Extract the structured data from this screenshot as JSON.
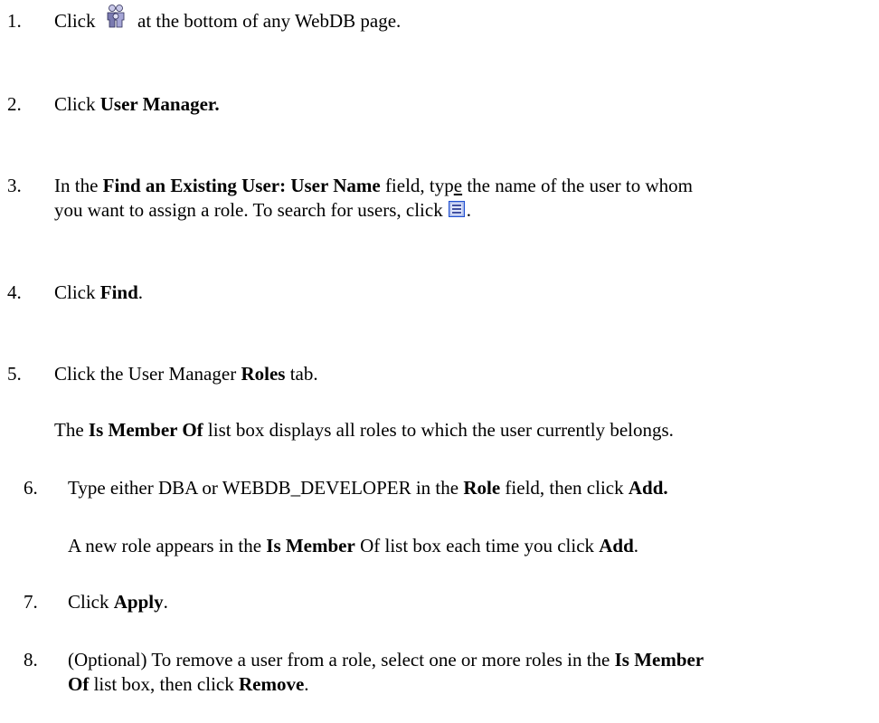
{
  "steps": [
    {
      "num": "1.",
      "pre": "Click",
      "post": "at the bottom of any WebDB page."
    },
    {
      "num": "2.",
      "pre": "Click ",
      "bold": "User Manager."
    },
    {
      "num": "3.",
      "pre": "In the ",
      "bold": "Find an Existing User: User Name",
      "mid": " field, typ",
      "u": "e",
      "mid2": " the name of the user to whom",
      "line2": "you want to assign a role. To search for users, click",
      "line2_end": "."
    },
    {
      "num": "4.",
      "pre": "Click ",
      "bold": "Find",
      "post": "."
    },
    {
      "num": "5.",
      "pre": "Click the User Manager ",
      "bold": "Roles",
      "post": " tab."
    },
    {
      "note_pre": "The ",
      "note_bold": "Is Member Of",
      "note_post": " list box displays all roles to which the user currently belongs."
    },
    {
      "num": "6.",
      "pre": "Type either DBA or WEBDB_DEVELOPER in the ",
      "bold": "Role",
      "mid": " field, then click ",
      "bold2": "Add."
    },
    {
      "note_pre": "A new role appears in the ",
      "note_bold": "Is Member",
      "note_mid": " Of list box each time you click ",
      "note_bold2": "Add",
      "note_post": "."
    },
    {
      "num": "7.",
      "pre": "Click ",
      "bold": "Apply",
      "post": "."
    },
    {
      "num": "8.",
      "pre": "(Optional) To remove a user from a role, select one or more roles in the ",
      "bold": "Is Member",
      "line2_bold": "Of",
      "line2": " list box, then click ",
      "line2_bold2": "Remove",
      "line2_end": "."
    }
  ],
  "icons": {
    "step1": "people-group-icon",
    "step3": "list-lookup-icon"
  },
  "colors": {
    "text": "#000000",
    "icon_blue": "#1f4fd0"
  }
}
